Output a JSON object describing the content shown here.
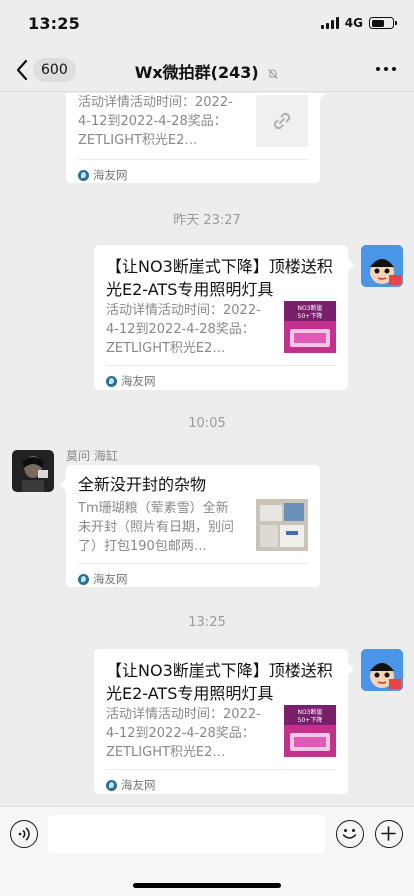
{
  "status": {
    "time": "13:25",
    "network": "4G",
    "battery_level": 0.6
  },
  "nav": {
    "back_count": "600",
    "title": "Wx微拍群(243)",
    "mute_icon": "bell-off-icon",
    "more_icon": "more-dots-icon"
  },
  "messages": [
    {
      "type": "link-card",
      "side": "right",
      "desc": "活动详情活动时间：2022-4-12到2022-4-28奖品：ZETLIGHT积光E2…",
      "thumb": "link-icon",
      "source": "海友网"
    },
    {
      "type": "timestamp",
      "text": "昨天 23:27"
    },
    {
      "type": "link-card",
      "side": "right",
      "title": "【让NO3断崖式下降】顶楼送积光E2-ATS专用照明灯具",
      "desc": "活动详情活动时间：2022-4-12到2022-4-28奖品：ZETLIGHT积光E2…",
      "thumb": "product-image",
      "thumb_text": "NO3断崖\n50+下降",
      "source": "海友网"
    },
    {
      "type": "timestamp",
      "text": "10:05"
    },
    {
      "type": "link-card",
      "side": "left",
      "sender": "莫问 海缸",
      "title": "全新没开封的杂物",
      "desc": "Tm珊瑚粮（荤素雪）全新未开封（照片有日期，别问了）打包190包邮两…",
      "thumb": "product-photo",
      "source": "海友网"
    },
    {
      "type": "timestamp",
      "text": "13:25"
    },
    {
      "type": "link-card",
      "side": "right",
      "title": "【让NO3断崖式下降】顶楼送积光E2-ATS专用照明灯具",
      "desc": "活动详情活动时间：2022-4-12到2022-4-28奖品：ZETLIGHT积光E2…",
      "thumb": "product-image",
      "thumb_text": "NO3断崖\n50+下降",
      "source": "海友网"
    }
  ],
  "input": {
    "placeholder": ""
  },
  "colors": {
    "chat_bg": "#ededed",
    "bubble": "#ffffff",
    "accent_pink": "#d63aa0"
  }
}
